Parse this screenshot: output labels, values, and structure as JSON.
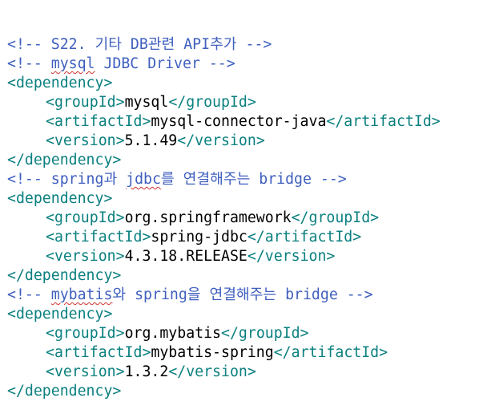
{
  "editor": {
    "lines": [
      {
        "kind": "comment",
        "parts": [
          {
            "t": "<!-- S22. 기타 DB관련 API추가 -->"
          }
        ]
      },
      {
        "kind": "comment",
        "parts": [
          {
            "t": "<!-- "
          },
          {
            "t": "mysql",
            "sq": true
          },
          {
            "t": " JDBC Driver -->"
          }
        ]
      },
      {
        "kind": "tag",
        "text": "<dependency>"
      },
      {
        "kind": "elem",
        "open": "<groupId>",
        "value": "mysql",
        "close": "</groupId>"
      },
      {
        "kind": "elem",
        "open": "<artifactId>",
        "value": "mysql-connector-java",
        "close": "</artifactId>"
      },
      {
        "kind": "elem",
        "open": "<version>",
        "value": "5.1.49",
        "close": "</version>"
      },
      {
        "kind": "tag",
        "text": "</dependency>"
      },
      {
        "kind": "comment",
        "parts": [
          {
            "t": "<!-- spring과 "
          },
          {
            "t": "jdbc",
            "sq": true
          },
          {
            "t": "를 연결해주는 bridge -->"
          }
        ]
      },
      {
        "kind": "tag",
        "text": "<dependency>"
      },
      {
        "kind": "elem",
        "open": "<groupId>",
        "value": "org.springframework",
        "close": "</groupId>"
      },
      {
        "kind": "elem",
        "open": "<artifactId>",
        "value": "spring-jdbc",
        "close": "</artifactId>"
      },
      {
        "kind": "elem",
        "open": "<version>",
        "value": "4.3.18.RELEASE",
        "close": "</version>"
      },
      {
        "kind": "tag",
        "text": "</dependency>"
      },
      {
        "kind": "comment",
        "parts": [
          {
            "t": "<!-- "
          },
          {
            "t": "mybatis",
            "sq": true
          },
          {
            "t": "와 spring을 연결해주는 bridge -->"
          }
        ]
      },
      {
        "kind": "tag",
        "text": "<dependency>"
      },
      {
        "kind": "elem",
        "open": "<groupId>",
        "value": "org.mybatis",
        "close": "</groupId>"
      },
      {
        "kind": "elem",
        "open": "<artifactId>",
        "value": "mybatis-spring",
        "close": "</artifactId>"
      },
      {
        "kind": "elem",
        "open": "<version>",
        "value": "1.3.2",
        "close": "</version>"
      },
      {
        "kind": "tag",
        "text": "</dependency>"
      }
    ],
    "colors": {
      "comment": "#3f5fbf",
      "tag": "#0a7f7f",
      "text": "#000000",
      "spellcheck": "#d03030",
      "background": "#ffffff"
    }
  }
}
